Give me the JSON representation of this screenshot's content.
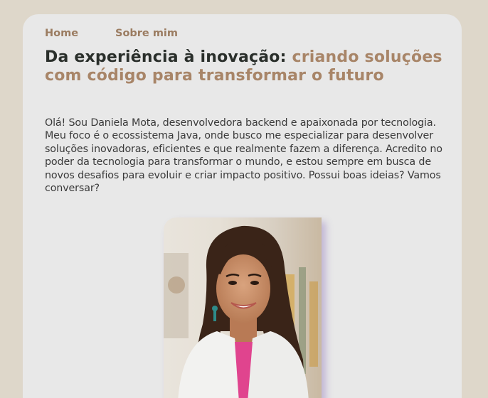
{
  "nav": {
    "items": [
      {
        "label": "Home"
      },
      {
        "label": "Sobre mim"
      }
    ]
  },
  "hero": {
    "title_part1": "Da experiência à inovação: ",
    "title_part2": "criando soluções com código para transformar o futuro",
    "intro": "Olá! Sou Daniela Mota, desenvolvedora backend e apaixonada por tecnologia. Meu foco é o ecossistema Java, onde busco me especializar para desenvolver soluções inovadoras, eficientes e que realmente fazem a diferença. Acredito no poder da tecnologia para transformar o mundo, e estou sempre em busca de novos desafios para evoluir e criar impacto positivo. Possui boas ideias? Vamos conversar?"
  },
  "colors": {
    "page_background": "#DED7CA",
    "card_background": "#E8E8E8",
    "accent": "#A88568",
    "nav_link": "#9B7C61",
    "heading": "#2A2F2B"
  }
}
